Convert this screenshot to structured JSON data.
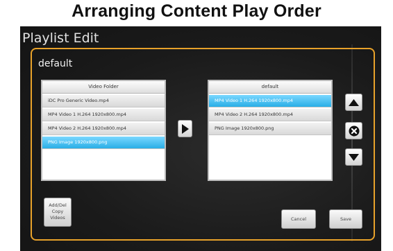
{
  "caption": "Arranging Content Play Order",
  "window": {
    "title": "Playlist Edit"
  },
  "playlist": {
    "name": "default"
  },
  "source_panel": {
    "header": "Video Folder",
    "items": [
      {
        "label": "iDC Pro Generic Video.mp4",
        "selected": false
      },
      {
        "label": "MP4 Video 1 H.264 1920x800.mp4",
        "selected": false
      },
      {
        "label": "MP4 Video 2 H.264 1920x800.mp4",
        "selected": false
      },
      {
        "label": "PNG Image 1920x800.png",
        "selected": true
      }
    ]
  },
  "target_panel": {
    "header": "default",
    "items": [
      {
        "label": "MP4 Video 1 H.264 1920x800.mp4",
        "selected": true
      },
      {
        "label": "MP4 Video 2 H.264 1920x800.mp4",
        "selected": false
      },
      {
        "label": "PNG Image 1920x800.png",
        "selected": false
      }
    ]
  },
  "icons": {
    "add": "play-right-icon",
    "move_up": "triangle-up-icon",
    "remove": "circle-x-icon",
    "move_down": "triangle-down-icon"
  },
  "buttons": {
    "add_del": "Add/Del",
    "copy": "Copy",
    "videos": "Videos",
    "cancel": "Cancel",
    "save": "Save"
  },
  "colors": {
    "frame": "#e8a22a",
    "selected_row": "#29aee6",
    "background": "#1b1b1b"
  }
}
